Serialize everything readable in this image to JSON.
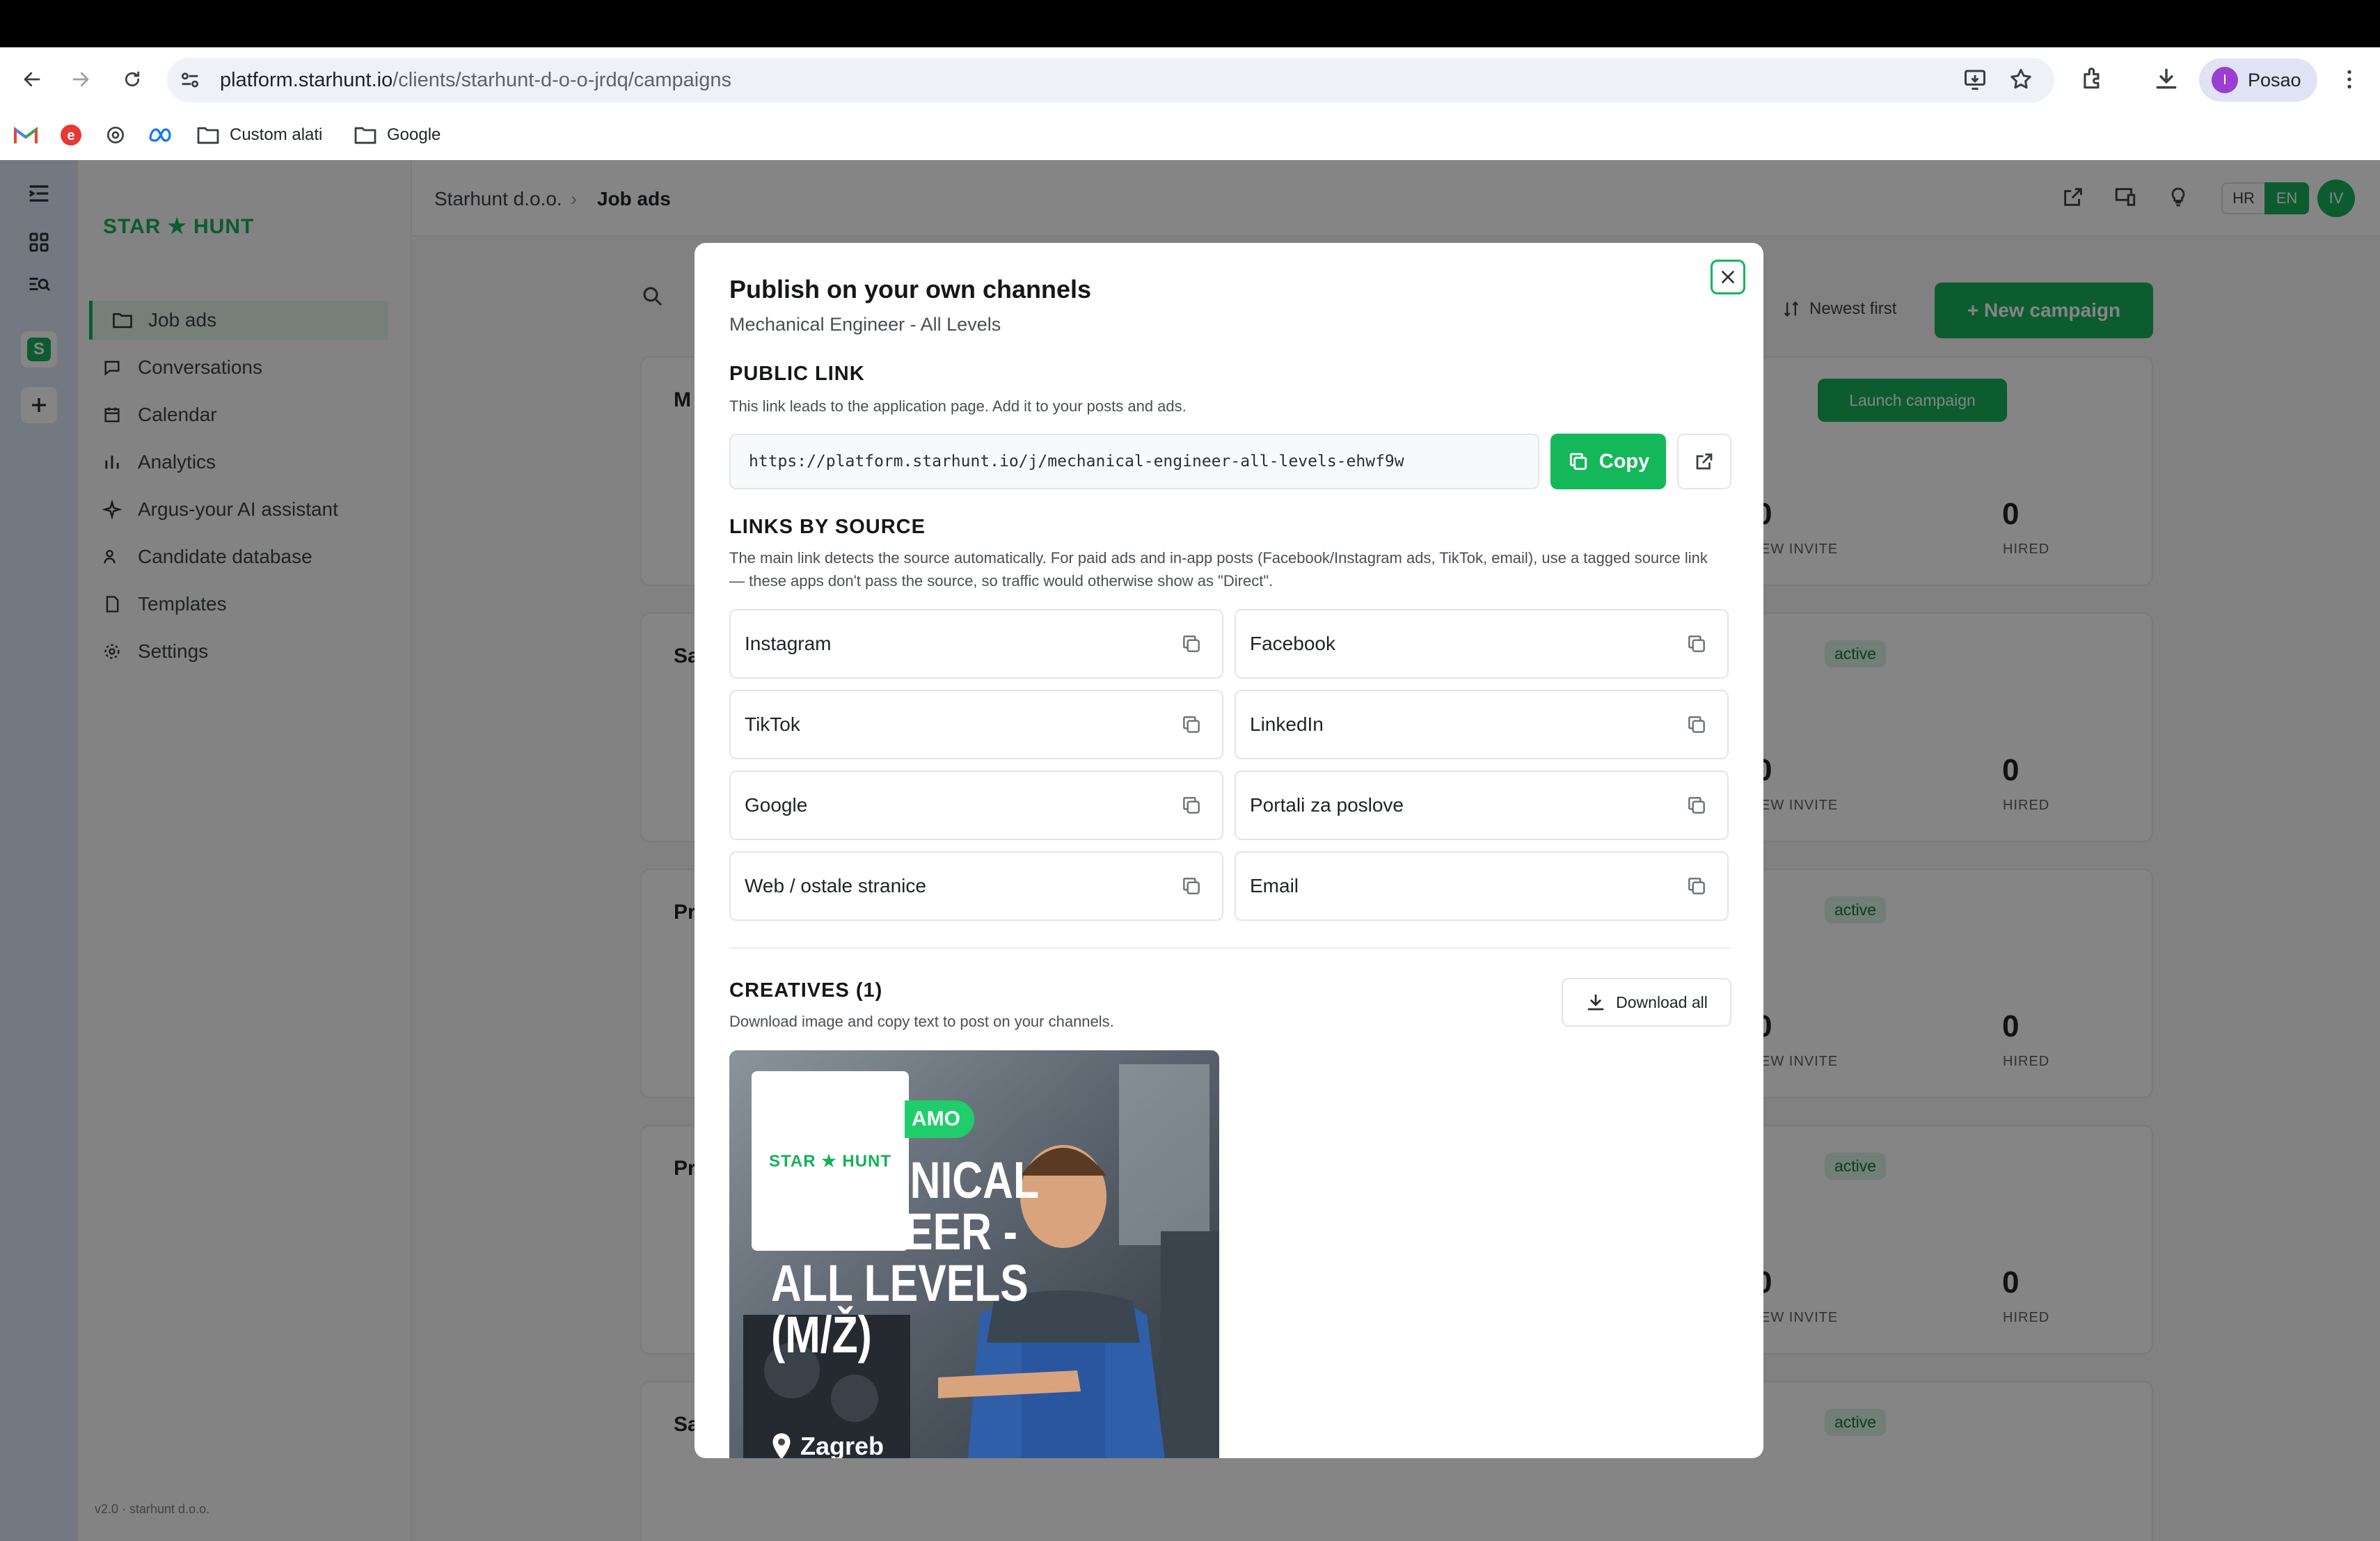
{
  "browser": {
    "url_domain": "platform.starhunt.io",
    "url_path": "/clients/starhunt-d-o-o-jrdq/campaigns",
    "bookmarks": [
      "Custom alati",
      "Google"
    ],
    "profile_initial": "I",
    "profile_name": "Posao"
  },
  "app": {
    "logo": "STAR ★ HUNT",
    "breadcrumb": [
      "Starhunt d.o.o.",
      "Job ads"
    ],
    "nav": [
      "Job ads",
      "Conversations",
      "Calendar",
      "Analytics",
      "Argus-your AI assistant",
      "Candidate database",
      "Templates",
      "Settings"
    ],
    "lang": [
      "HR",
      "EN"
    ],
    "user_initials": "IV",
    "sort_label": "Newest first",
    "new_campaign": "+ New campaign",
    "launch_campaign": "Launch campaign",
    "status_active": "active",
    "stat_hired": "HIRED",
    "stat_interview": "EW INVITE",
    "zero": "0",
    "version": "v2.0 · starhunt d.o.o.",
    "card_initials": [
      "M",
      "Sa",
      "Pr",
      "Pr",
      "Sa"
    ]
  },
  "modal": {
    "title": "Publish on your own channels",
    "subtitle": "Mechanical Engineer - All Levels",
    "public_link": {
      "heading": "PUBLIC LINK",
      "description": "This link leads to the application page. Add it to your posts and ads.",
      "url": "https://platform.starhunt.io/j/mechanical-engineer-all-levels-ehwf9w",
      "copy_label": "Copy"
    },
    "links_by_source": {
      "heading": "LINKS BY SOURCE",
      "description": "The main link detects the source automatically. For paid ads and in-app posts (Facebook/Instagram ads, TikTok, email), use a tagged source link — these apps don't pass the source, so traffic would otherwise show as \"Direct\".",
      "sources": [
        "Instagram",
        "Facebook",
        "TikTok",
        "LinkedIn",
        "Google",
        "Portali za poslove",
        "Web / ostale stranice",
        "Email"
      ]
    },
    "creatives": {
      "heading": "CREATIVES (1)",
      "description": "Download image and copy text to post on your channels.",
      "download_all": "Download all",
      "image": {
        "logo": "STAR ★ HUNT",
        "banner": "AMO",
        "headline": [
          "ANICAL",
          "ENGINEER -",
          "ALL LEVELS",
          "(M/Ž)"
        ],
        "location": "Zagreb"
      }
    }
  },
  "colors": {
    "brand_green": "#14b85a",
    "overlay": "rgba(0,0,0,0.48)"
  }
}
